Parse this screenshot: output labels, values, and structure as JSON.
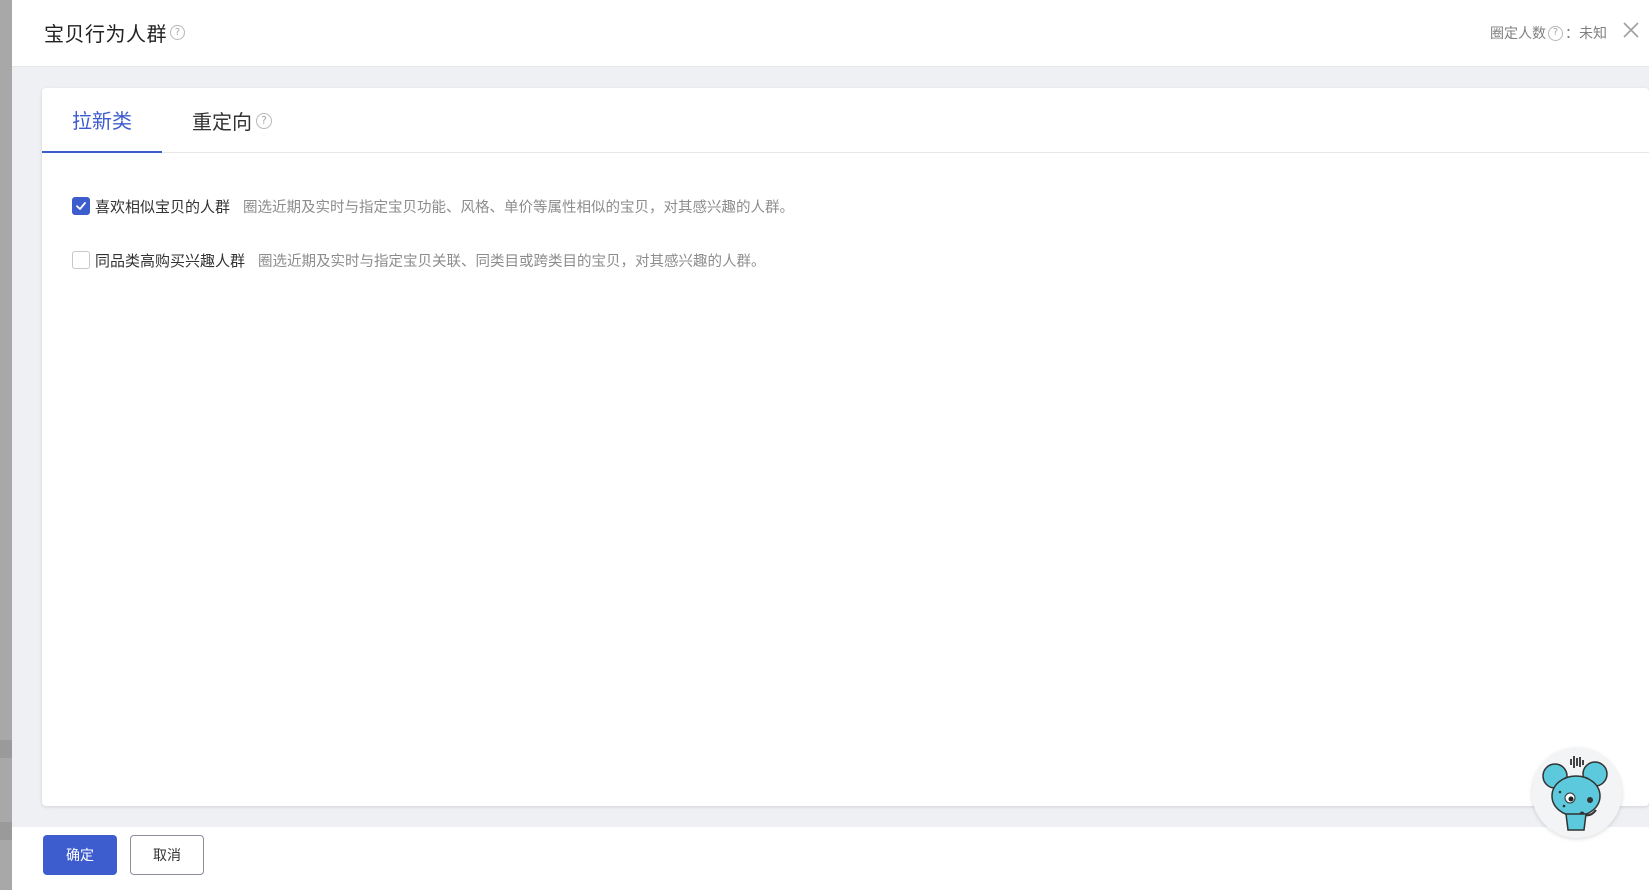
{
  "header": {
    "title": "宝贝行为人群",
    "count_label": "圈定人数",
    "count_separator": "：",
    "count_value": "未知"
  },
  "tabs": [
    {
      "label": "拉新类",
      "active": true
    },
    {
      "label": "重定向",
      "active": false
    }
  ],
  "options": [
    {
      "label": "喜欢相似宝贝的人群",
      "description": "圈选近期及实时与指定宝贝功能、风格、单价等属性相似的宝贝，对其感兴趣的人群。",
      "checked": true
    },
    {
      "label": "同品类高购买兴趣人群",
      "description": "圈选近期及实时与指定宝贝关联、同类目或跨类目的宝贝，对其感兴趣的人群。",
      "checked": false
    }
  ],
  "footer": {
    "confirm_label": "确定",
    "cancel_label": "取消"
  },
  "icons": {
    "help": "?",
    "close": "close-icon",
    "check": "check-icon",
    "assistant": "mouse-assistant-icon"
  },
  "colors": {
    "accent": "#3d5ccd",
    "text": "#333333",
    "muted": "#8c8c8c"
  }
}
